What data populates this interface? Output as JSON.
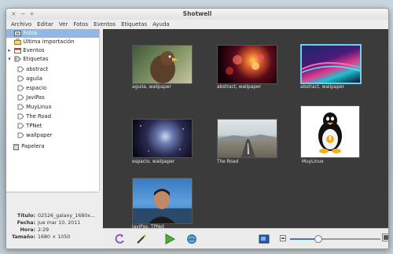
{
  "window": {
    "title": "Shotwell",
    "controls": [
      "×",
      "−",
      "+"
    ]
  },
  "menu": [
    "Archivo",
    "Editar",
    "Ver",
    "Fotos",
    "Eventos",
    "Etiquetas",
    "Ayuda"
  ],
  "sidebar": {
    "items": [
      {
        "label": "Fotos",
        "icon": "photos-icon",
        "selected": true
      },
      {
        "label": "Última importación",
        "icon": "last-import-icon"
      },
      {
        "label": "Eventos",
        "icon": "events-icon",
        "expander": "▸"
      },
      {
        "label": "Etiquetas",
        "icon": "tags-icon",
        "expander": "▾"
      }
    ],
    "tags": [
      "abstract",
      "aguila",
      "espacio",
      "JaviPas",
      "MuyLinux",
      "The Road",
      "TPNet",
      "wallpaper"
    ],
    "trash": {
      "label": "Papelera",
      "icon": "trash-icon"
    }
  },
  "info": {
    "title_label": "Título:",
    "title_value": "02526_galaxy_1680x...",
    "date_label": "Fecha:",
    "date_value": "jue mar 10, 2011",
    "time_label": "Hora:",
    "time_value": "2:29",
    "size_label": "Tamaño:",
    "size_value": "1680 × 1050"
  },
  "photos": [
    {
      "caption": "aguila, wallpaper"
    },
    {
      "caption": "abstract, wallpaper"
    },
    {
      "caption": "abstract, wallpaper",
      "selected": true
    },
    {
      "caption": "espacio, wallpaper"
    },
    {
      "caption": "The Road"
    },
    {
      "caption": "MuyLinux"
    },
    {
      "caption": "JaviPas, TPNet"
    }
  ],
  "toolbar": {
    "buttons": [
      "rotate-icon",
      "enhance-icon",
      "play-slideshow-icon",
      "publish-icon"
    ],
    "right_buttons": [
      "fullscreen-icon"
    ],
    "zoom_level": 0.3
  },
  "colors": {
    "selection": "#90b8e3",
    "thumb_selected": "#6fd1e6",
    "viewer_bg": "#3b3b3b"
  }
}
